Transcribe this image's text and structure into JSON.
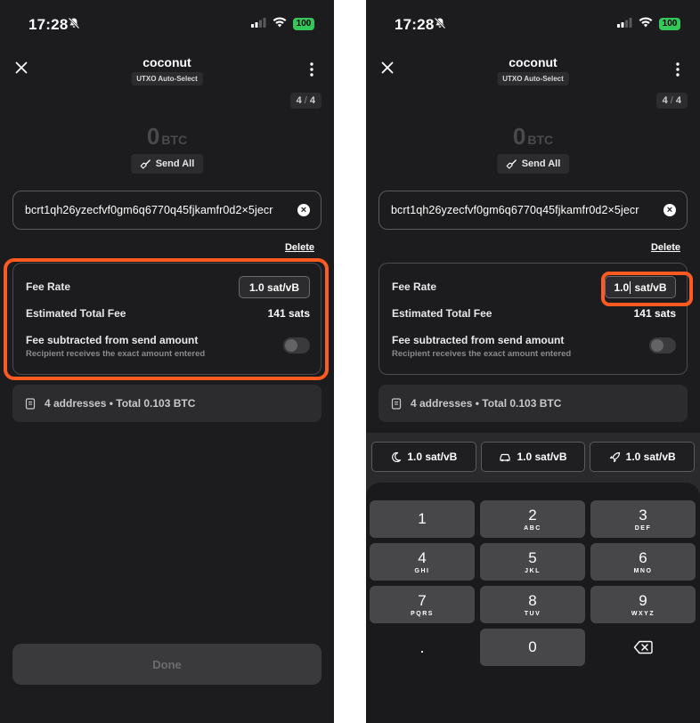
{
  "left": {
    "status": {
      "time": "17:28",
      "battery": "100"
    },
    "nav": {
      "title": "coconut",
      "chip": "UTXO Auto-Select"
    },
    "page": {
      "current": "4",
      "sep": "/",
      "total": "4"
    },
    "amount": {
      "value": "0",
      "unit": "BTC"
    },
    "send_all": "Send All",
    "address": "bcrt1qh26yzecfvf0gm6q6770q45fjkamfr0d2×5jecr",
    "delete": "Delete",
    "fee": {
      "rate_label": "Fee Rate",
      "rate_value": "1.0 sat/vB",
      "total_label": "Estimated Total Fee",
      "total_value": "141 sats",
      "sub_label": "Fee subtracted from send amount",
      "sub_desc": "Recipient receives the exact amount entered",
      "toggle_on": false
    },
    "summary": "4 addresses • Total 0.103 BTC",
    "done": "Done"
  },
  "right": {
    "status": {
      "time": "17:28",
      "battery": "100"
    },
    "nav": {
      "title": "coconut",
      "chip": "UTXO Auto-Select"
    },
    "page": {
      "current": "4",
      "sep": "/",
      "total": "4"
    },
    "amount": {
      "value": "0",
      "unit": "BTC"
    },
    "send_all": "Send All",
    "address": "bcrt1qh26yzecfvf0gm6q6770q45fjkamfr0d2×5jecr",
    "delete": "Delete",
    "fee": {
      "rate_label": "Fee Rate",
      "rate_before_caret": "1.0",
      "rate_after_caret": "sat/vB",
      "total_label": "Estimated Total Fee",
      "total_value": "141 sats",
      "sub_label": "Fee subtracted from send amount",
      "sub_desc": "Recipient receives the exact amount entered",
      "toggle_on": false
    },
    "summary": "4 addresses • Total 0.103 BTC",
    "presets": [
      {
        "icon": "moon-icon",
        "label": "1.0 sat/vB"
      },
      {
        "icon": "car-icon",
        "label": "1.0 sat/vB"
      },
      {
        "icon": "rocket-icon",
        "label": "1.0 sat/vB"
      }
    ],
    "keypad": [
      {
        "digit": "1",
        "letters": ""
      },
      {
        "digit": "2",
        "letters": "ABC"
      },
      {
        "digit": "3",
        "letters": "DEF"
      },
      {
        "digit": "4",
        "letters": "GHI"
      },
      {
        "digit": "5",
        "letters": "JKL"
      },
      {
        "digit": "6",
        "letters": "MNO"
      },
      {
        "digit": "7",
        "letters": "PQRS"
      },
      {
        "digit": "8",
        "letters": "TUV"
      },
      {
        "digit": "9",
        "letters": "WXYZ"
      },
      {
        "digit": ".",
        "letters": ""
      },
      {
        "digit": "0",
        "letters": ""
      }
    ]
  },
  "colors": {
    "highlight": "#ff5a1f",
    "background": "#1c1c1e",
    "battery": "#34c759"
  }
}
